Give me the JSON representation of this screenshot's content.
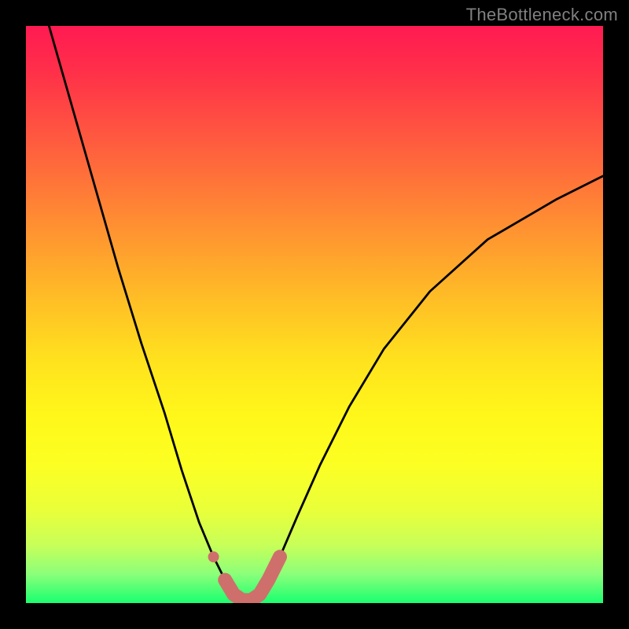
{
  "watermark": "TheBottleneck.com",
  "chart_data": {
    "type": "line",
    "title": "",
    "xlabel": "",
    "ylabel": "",
    "xlim": [
      0,
      100
    ],
    "ylim": [
      0,
      100
    ],
    "series": [
      {
        "name": "curve",
        "x": [
          4,
          8,
          12,
          16,
          20,
          24,
          27,
          30,
          32.5,
          34.5,
          36,
          37.5,
          39,
          40.5,
          42,
          44,
          47,
          51,
          56,
          62,
          70,
          80,
          92,
          100
        ],
        "values": [
          100,
          86,
          72,
          58,
          45,
          33,
          23,
          14,
          8,
          4,
          1.5,
          0.5,
          0.5,
          1.5,
          4,
          8,
          15,
          24,
          34,
          44,
          54,
          63,
          70,
          74
        ]
      }
    ],
    "colors": {
      "curve": "#000000",
      "highlight": "#cf6f6c",
      "gradient_top": "#ff1a52",
      "gradient_bottom": "#1aff70"
    },
    "annotations": [
      {
        "type": "highlight-segment",
        "x_range": [
          33,
          44
        ],
        "note": "thick pink U at bottom"
      },
      {
        "type": "dot",
        "x": 32.5,
        "y": 8,
        "note": "small pink dot on left branch"
      }
    ]
  }
}
